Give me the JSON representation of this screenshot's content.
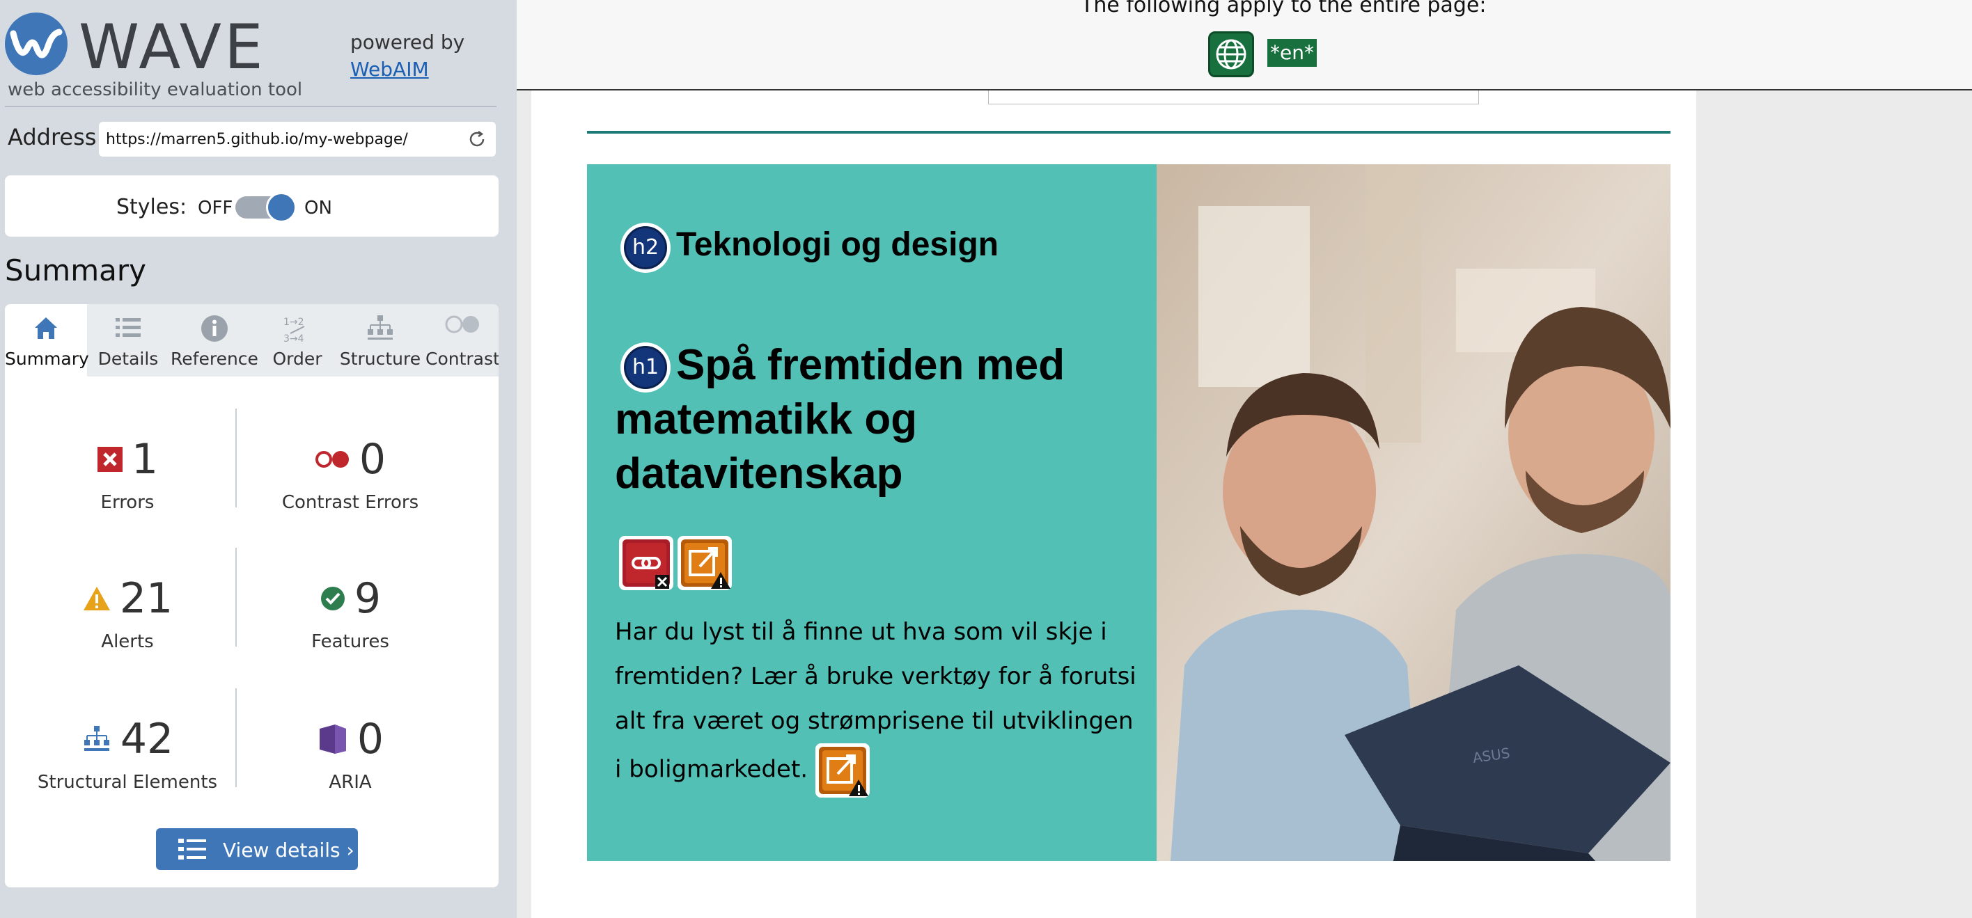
{
  "wave": {
    "name": "WAVE",
    "subtitle": "web accessibility evaluation tool",
    "powered_by": "powered by",
    "webaim_link": "WebAIM"
  },
  "address": {
    "label": "Address:",
    "value": "https://marren5.github.io/my-webpage/"
  },
  "styles": {
    "label": "Styles:",
    "off": "OFF",
    "on": "ON",
    "enabled": true
  },
  "summary": {
    "title": "Summary",
    "tabs": [
      {
        "label": "Summary",
        "icon": "home-icon",
        "active": true
      },
      {
        "label": "Details",
        "icon": "list-icon",
        "active": false
      },
      {
        "label": "Reference",
        "icon": "info-icon",
        "active": false
      },
      {
        "label": "Order",
        "icon": "order-icon",
        "active": false
      },
      {
        "label": "Structure",
        "icon": "structure-icon",
        "active": false
      },
      {
        "label": "Contrast",
        "icon": "contrast-icon",
        "active": false
      }
    ],
    "stats": {
      "errors": {
        "count": "1",
        "label": "Errors",
        "color": "#c0272d"
      },
      "contrast_errors": {
        "count": "0",
        "label": "Contrast Errors",
        "color": "#c0272d"
      },
      "alerts": {
        "count": "21",
        "label": "Alerts",
        "color": "#e8a21a"
      },
      "features": {
        "count": "9",
        "label": "Features",
        "color": "#2e7d4f"
      },
      "structural": {
        "count": "42",
        "label": "Structural Elements",
        "color": "#3e76b8"
      },
      "aria": {
        "count": "0",
        "label": "ARIA",
        "color": "#5b3a8c"
      }
    },
    "view_details": "View details ›"
  },
  "page_info": {
    "text": "The following apply to the entire page:",
    "lang": "*en*"
  },
  "hero": {
    "h2_badge": "h2",
    "h2": "Teknologi og design",
    "h1_badge": "h1",
    "h1": "Spå fremtiden med matematikk og datavitenskap",
    "body": "Har du lyst til å finne ut hva som vil skje i fremtiden? Lær å bruke verktøy for å forutsi alt fra været og strømprisene til utviklingen i boligmarkedet.",
    "accent": "#52c0b4"
  }
}
